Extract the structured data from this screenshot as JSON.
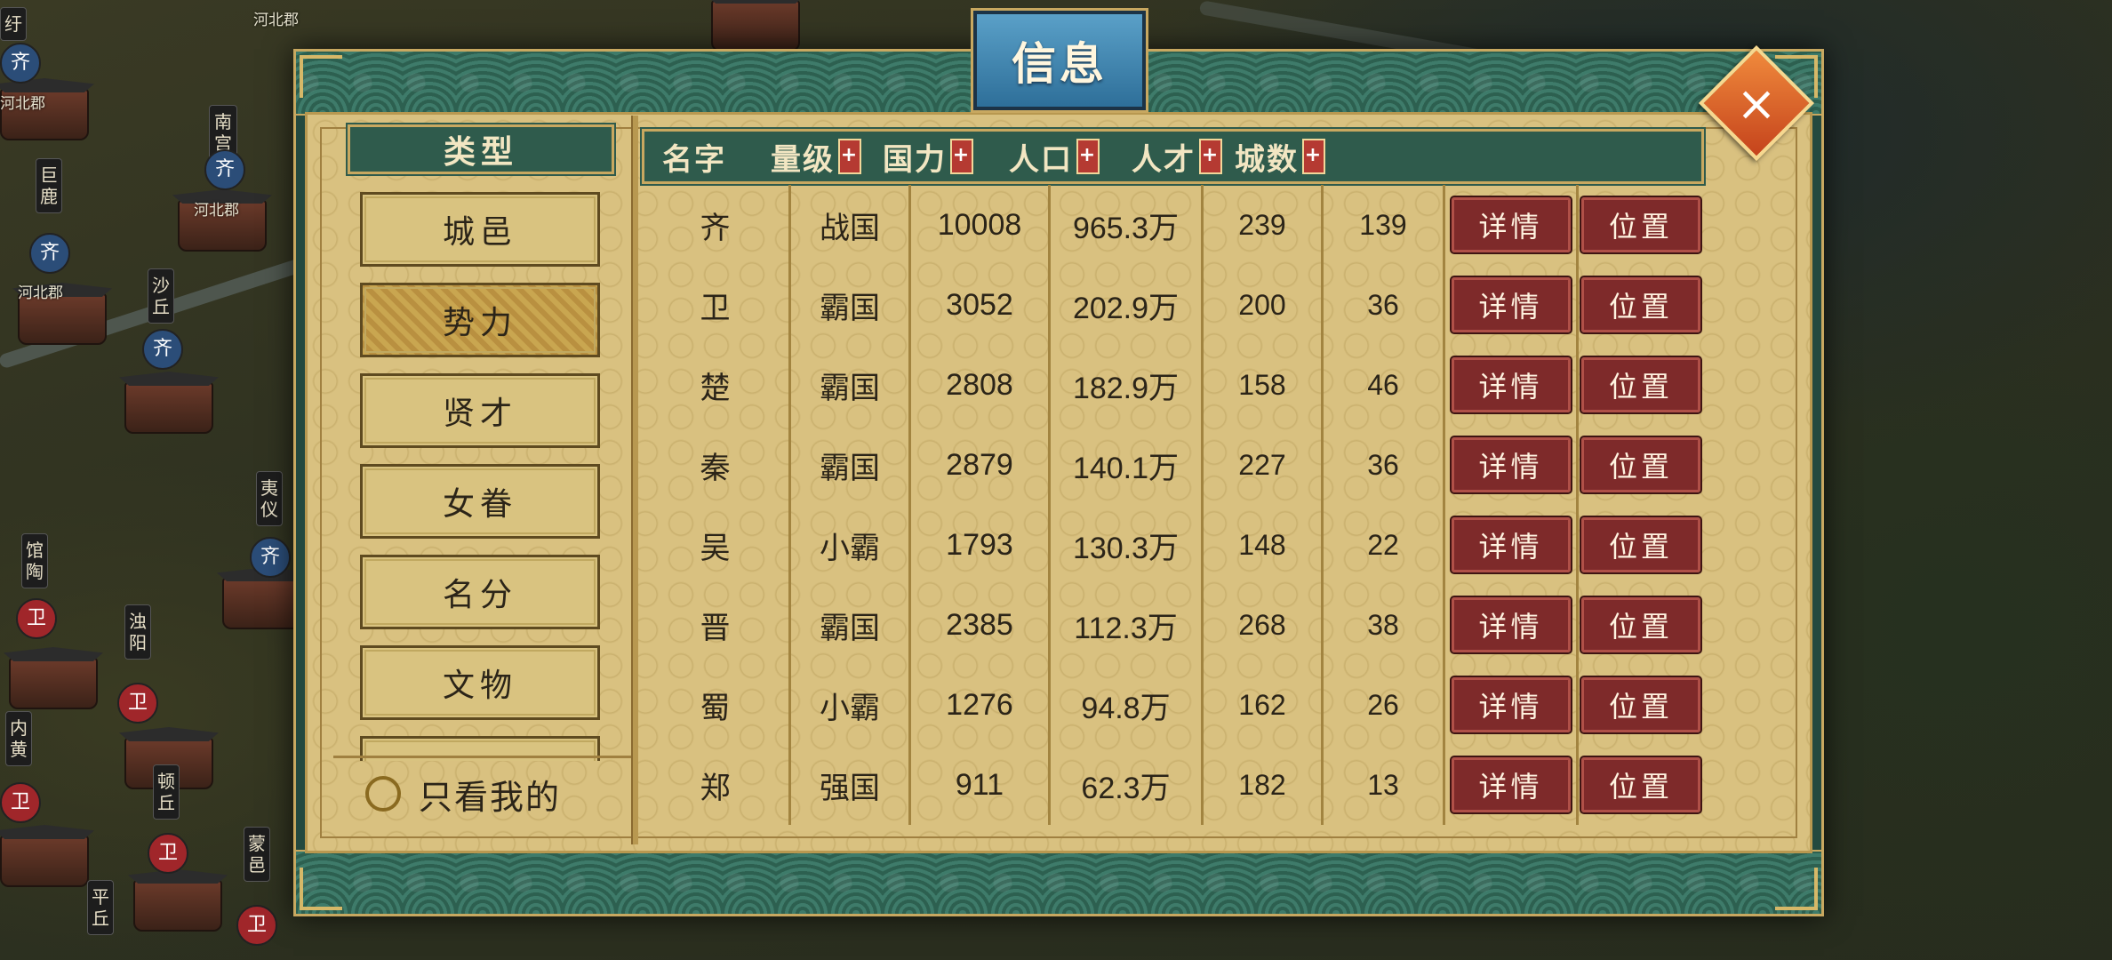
{
  "map": {
    "labels": [
      "河北郡",
      "河北郡",
      "河北郡",
      "河北郡"
    ],
    "vertical_tags": [
      "南宫",
      "巨鹿",
      "沙丘",
      "馆陶",
      "浊阳",
      "内黄",
      "顿丘",
      "平丘",
      "蒙邑",
      "夷仪",
      "纡"
    ],
    "badges": [
      "齐",
      "齐",
      "齐",
      "齐",
      "齐",
      "卫",
      "卫",
      "卫",
      "卫",
      "卫"
    ]
  },
  "dialog": {
    "title": "信息",
    "close_icon": "×"
  },
  "sidebar": {
    "header": "类型",
    "items": [
      {
        "label": "城邑",
        "active": false
      },
      {
        "label": "势力",
        "active": true
      },
      {
        "label": "贤才",
        "active": false
      },
      {
        "label": "女眷",
        "active": false
      },
      {
        "label": "名分",
        "active": false
      },
      {
        "label": "文物",
        "active": false
      }
    ],
    "only_mine_label": "只看我的"
  },
  "table": {
    "columns": {
      "name": "名字",
      "rank": "量级",
      "power": "国力",
      "population": "人口",
      "talent": "人才",
      "cities": "城数"
    },
    "sort_icon": "+",
    "detail_label": "详情",
    "locate_label": "位置",
    "rows": [
      {
        "name": "齐",
        "rank": "战国",
        "power": "10008",
        "population": "965.3万",
        "talent": "239",
        "cities": "139"
      },
      {
        "name": "卫",
        "rank": "霸国",
        "power": "3052",
        "population": "202.9万",
        "talent": "200",
        "cities": "36"
      },
      {
        "name": "楚",
        "rank": "霸国",
        "power": "2808",
        "population": "182.9万",
        "talent": "158",
        "cities": "46"
      },
      {
        "name": "秦",
        "rank": "霸国",
        "power": "2879",
        "population": "140.1万",
        "talent": "227",
        "cities": "36"
      },
      {
        "name": "吴",
        "rank": "小霸",
        "power": "1793",
        "population": "130.3万",
        "talent": "148",
        "cities": "22"
      },
      {
        "name": "晋",
        "rank": "霸国",
        "power": "2385",
        "population": "112.3万",
        "talent": "268",
        "cities": "38"
      },
      {
        "name": "蜀",
        "rank": "小霸",
        "power": "1276",
        "population": "94.8万",
        "talent": "162",
        "cities": "26"
      },
      {
        "name": "郑",
        "rank": "强国",
        "power": "911",
        "population": "62.3万",
        "talent": "182",
        "cities": "13"
      }
    ]
  }
}
